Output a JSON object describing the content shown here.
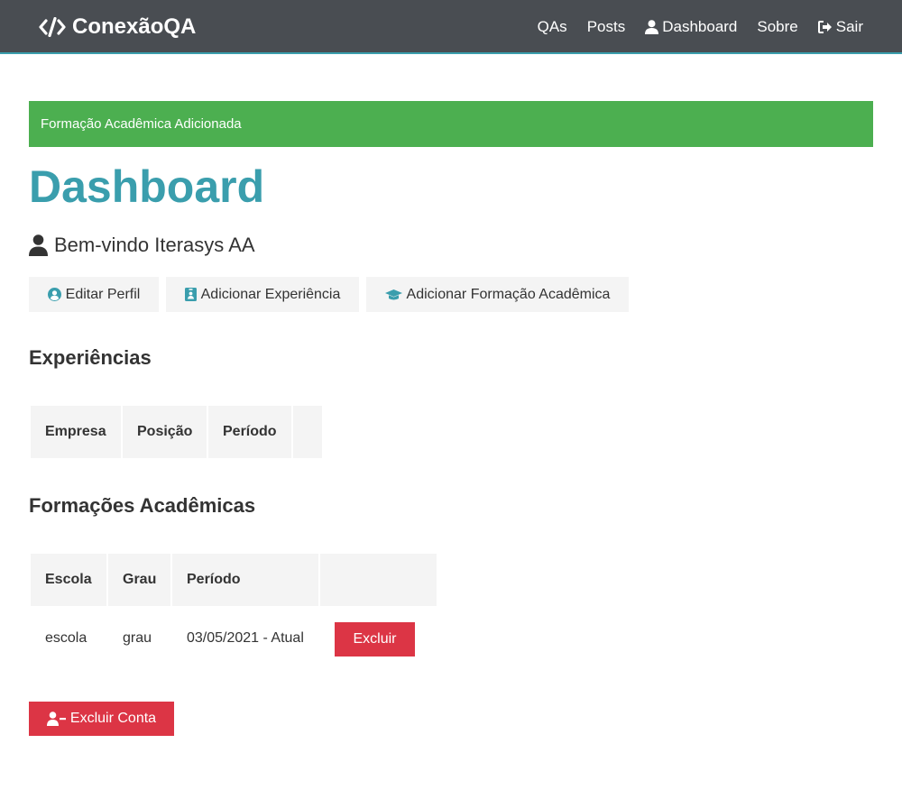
{
  "navbar": {
    "brand": "ConexãoQA",
    "links": [
      "QAs",
      "Posts",
      "Dashboard",
      "Sobre",
      "Sair"
    ]
  },
  "alert": {
    "text": "Formação Acadêmica Adicionada",
    "color": "#4caf50"
  },
  "page": {
    "title": "Dashboard",
    "welcome": "Bem-vindo Iterasys AA"
  },
  "actions": {
    "edit_profile": "Editar Perfil",
    "add_experience": "Adicionar Experiência",
    "add_education": "Adicionar Formação Acadêmica"
  },
  "experiences": {
    "title": "Experiências",
    "headers": [
      "Empresa",
      "Posição",
      "Período",
      ""
    ]
  },
  "education": {
    "title": "Formações Acadêmicas",
    "headers": [
      "Escola",
      "Grau",
      "Período",
      ""
    ],
    "rows": [
      {
        "school": "escola",
        "degree": "grau",
        "period": "03/05/2021 - Atual",
        "delete_label": "Excluir"
      }
    ]
  },
  "delete_account": {
    "label": "Excluir Conta"
  },
  "colors": {
    "accent": "#3a9ead",
    "danger": "#dc3545",
    "navbar": "#494d52"
  }
}
